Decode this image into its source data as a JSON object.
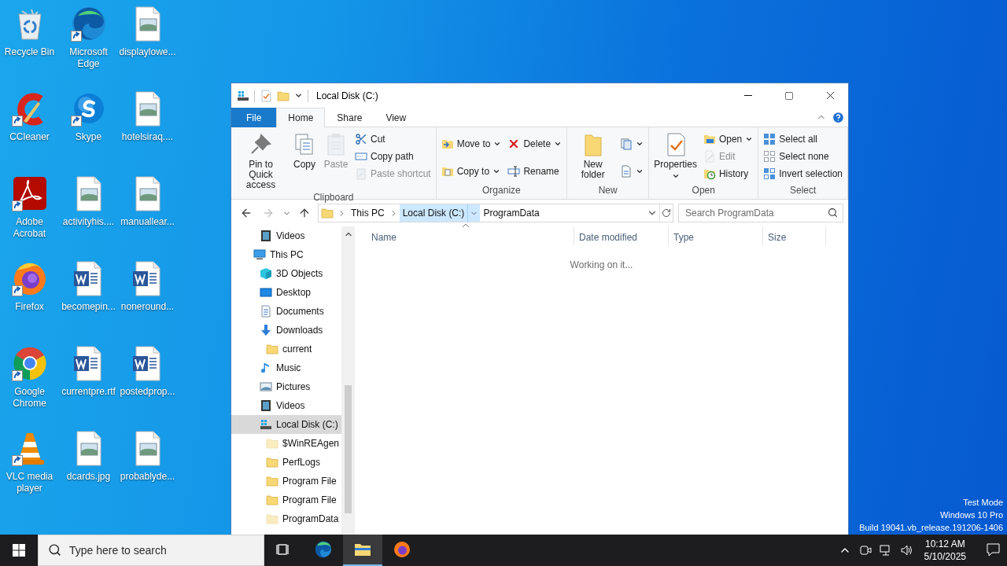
{
  "desktop_icons": [
    {
      "label": "Recycle Bin",
      "kind": "recycle-bin",
      "shortcut": false
    },
    {
      "label": "Microsoft Edge",
      "kind": "edge",
      "shortcut": true
    },
    {
      "label": "displaylowe...",
      "kind": "image",
      "shortcut": false
    },
    {
      "label": "CCleaner",
      "kind": "ccleaner",
      "shortcut": true
    },
    {
      "label": "Skype",
      "kind": "skype",
      "shortcut": true
    },
    {
      "label": "hotelsiraq....",
      "kind": "image",
      "shortcut": false
    },
    {
      "label": "Adobe Acrobat",
      "kind": "acrobat",
      "shortcut": true
    },
    {
      "label": "activityhis....",
      "kind": "image",
      "shortcut": false
    },
    {
      "label": "manuallear...",
      "kind": "image",
      "shortcut": false
    },
    {
      "label": "Firefox",
      "kind": "firefox",
      "shortcut": true
    },
    {
      "label": "becomepin...",
      "kind": "word-document",
      "shortcut": false
    },
    {
      "label": "noneround...",
      "kind": "word-document",
      "shortcut": false
    },
    {
      "label": "Google Chrome",
      "kind": "chrome",
      "shortcut": true
    },
    {
      "label": "currentpre.rtf",
      "kind": "word-document",
      "shortcut": false
    },
    {
      "label": "postedprop...",
      "kind": "word-document",
      "shortcut": false
    },
    {
      "label": "VLC media player",
      "kind": "vlc",
      "shortcut": true
    },
    {
      "label": "dcards.jpg",
      "kind": "image",
      "shortcut": false
    },
    {
      "label": "probablyde...",
      "kind": "image",
      "shortcut": false
    }
  ],
  "window": {
    "title": "Local Disk (C:)",
    "ribbon": {
      "tabs": [
        {
          "label": "File",
          "kind": "file",
          "selected": false
        },
        {
          "label": "Home",
          "kind": "tab",
          "selected": true
        },
        {
          "label": "Share",
          "kind": "tab",
          "selected": false
        },
        {
          "label": "View",
          "kind": "tab",
          "selected": false
        }
      ],
      "groups": [
        {
          "label": "Clipboard",
          "columns": [
            [
              {
                "kind": "large",
                "label": "Pin to Quick access",
                "disabled": false,
                "dropdown": false
              }
            ],
            [
              {
                "kind": "large",
                "label": "Copy",
                "disabled": false,
                "dropdown": false
              }
            ],
            [
              {
                "kind": "large",
                "label": "Paste",
                "disabled": true,
                "dropdown": false
              }
            ],
            [
              {
                "kind": "small",
                "label": "Cut",
                "disabled": false,
                "dropdown": false
              },
              {
                "kind": "small",
                "label": "Copy path",
                "disabled": false,
                "dropdown": false
              },
              {
                "kind": "small",
                "label": "Paste shortcut",
                "disabled": true,
                "dropdown": false
              }
            ]
          ]
        },
        {
          "label": "Organize",
          "columns": [
            [
              {
                "kind": "small",
                "label": "Move to",
                "disabled": false,
                "dropdown": true
              },
              {
                "kind": "small",
                "label": "Copy to",
                "disabled": false,
                "dropdown": true
              }
            ],
            [
              {
                "kind": "small",
                "label": "Delete",
                "disabled": false,
                "dropdown": true
              },
              {
                "kind": "small",
                "label": "Rename",
                "disabled": false,
                "dropdown": false
              }
            ]
          ]
        },
        {
          "label": "New",
          "columns": [
            [
              {
                "kind": "large",
                "label": "New folder",
                "disabled": false,
                "dropdown": false
              }
            ],
            [
              {
                "kind": "small",
                "disabled": false,
                "dropdown": true
              },
              {
                "kind": "small",
                "disabled": false,
                "dropdown": true
              }
            ]
          ]
        },
        {
          "label": "Open",
          "columns": [
            [
              {
                "kind": "large",
                "label": "Properties",
                "disabled": false,
                "dropdown": true
              }
            ],
            [
              {
                "kind": "small",
                "label": "Open",
                "disabled": false,
                "dropdown": true
              },
              {
                "kind": "small",
                "label": "Edit",
                "disabled": true,
                "dropdown": false
              },
              {
                "kind": "small",
                "label": "History",
                "disabled": false,
                "dropdown": false
              }
            ]
          ]
        },
        {
          "label": "Select",
          "columns": [
            [
              {
                "kind": "small",
                "label": "Select all",
                "disabled": false,
                "dropdown": false
              },
              {
                "kind": "small",
                "label": "Select none",
                "disabled": false,
                "dropdown": false
              },
              {
                "kind": "small",
                "label": "Invert selection",
                "disabled": false,
                "dropdown": false
              }
            ]
          ]
        }
      ]
    },
    "address_bar": {
      "back_enabled": true,
      "forward_enabled": false,
      "crumbs": [
        {
          "label": "This PC",
          "expanded": false
        },
        {
          "label": "Local Disk (C:)",
          "expanded": true
        },
        {
          "label": "ProgramData",
          "expanded": false
        }
      ]
    },
    "search": {
      "placeholder": "Search ProgramData"
    },
    "navigation_pane": {
      "quick_access_tail": [
        {
          "label": "Videos",
          "selected": false,
          "hidden": false
        }
      ],
      "items": [
        {
          "label": "This PC",
          "selected": false,
          "hidden": false,
          "children": [
            {
              "label": "3D Objects",
              "selected": false,
              "hidden": false
            },
            {
              "label": "Desktop",
              "selected": false,
              "hidden": false
            },
            {
              "label": "Documents",
              "selected": false,
              "hidden": false
            },
            {
              "label": "Downloads",
              "selected": false,
              "hidden": false,
              "children": [
                {
                  "label": "current",
                  "selected": false,
                  "hidden": false
                }
              ]
            },
            {
              "label": "Music",
              "selected": false,
              "hidden": false
            },
            {
              "label": "Pictures",
              "selected": false,
              "hidden": false
            },
            {
              "label": "Videos",
              "selected": false,
              "hidden": false
            },
            {
              "label": "Local Disk (C:)",
              "selected": true,
              "hidden": false,
              "children": [
                {
                  "label": "$WinREAgen",
                  "selected": false,
                  "hidden": true
                },
                {
                  "label": "PerfLogs",
                  "selected": false,
                  "hidden": false
                },
                {
                  "label": "Program File",
                  "selected": false,
                  "hidden": false
                },
                {
                  "label": "Program File",
                  "selected": false,
                  "hidden": false
                },
                {
                  "label": "ProgramData",
                  "selected": false,
                  "hidden": true
                }
              ]
            }
          ]
        }
      ]
    },
    "file_list": {
      "columns": [
        {
          "label": "Name",
          "sorted": true
        },
        {
          "label": "Date modified",
          "sorted": false
        },
        {
          "label": "Type",
          "sorted": false
        },
        {
          "label": "Size",
          "sorted": false
        }
      ],
      "status": "Working on it..."
    }
  },
  "desktop_text": [
    "Test Mode",
    "Windows 10 Pro",
    "Build 19041.vb_release.191206-1406"
  ],
  "taskbar": {
    "search": {
      "placeholder": "Type here to search"
    },
    "apps": [
      {
        "kind": "task-view",
        "selected": false
      },
      {
        "kind": "edge",
        "selected": false
      },
      {
        "kind": "explorer",
        "selected": true
      },
      {
        "kind": "firefox",
        "selected": false
      }
    ],
    "clock": {
      "time": "10:12 AM",
      "date": "5/10/2025"
    }
  }
}
